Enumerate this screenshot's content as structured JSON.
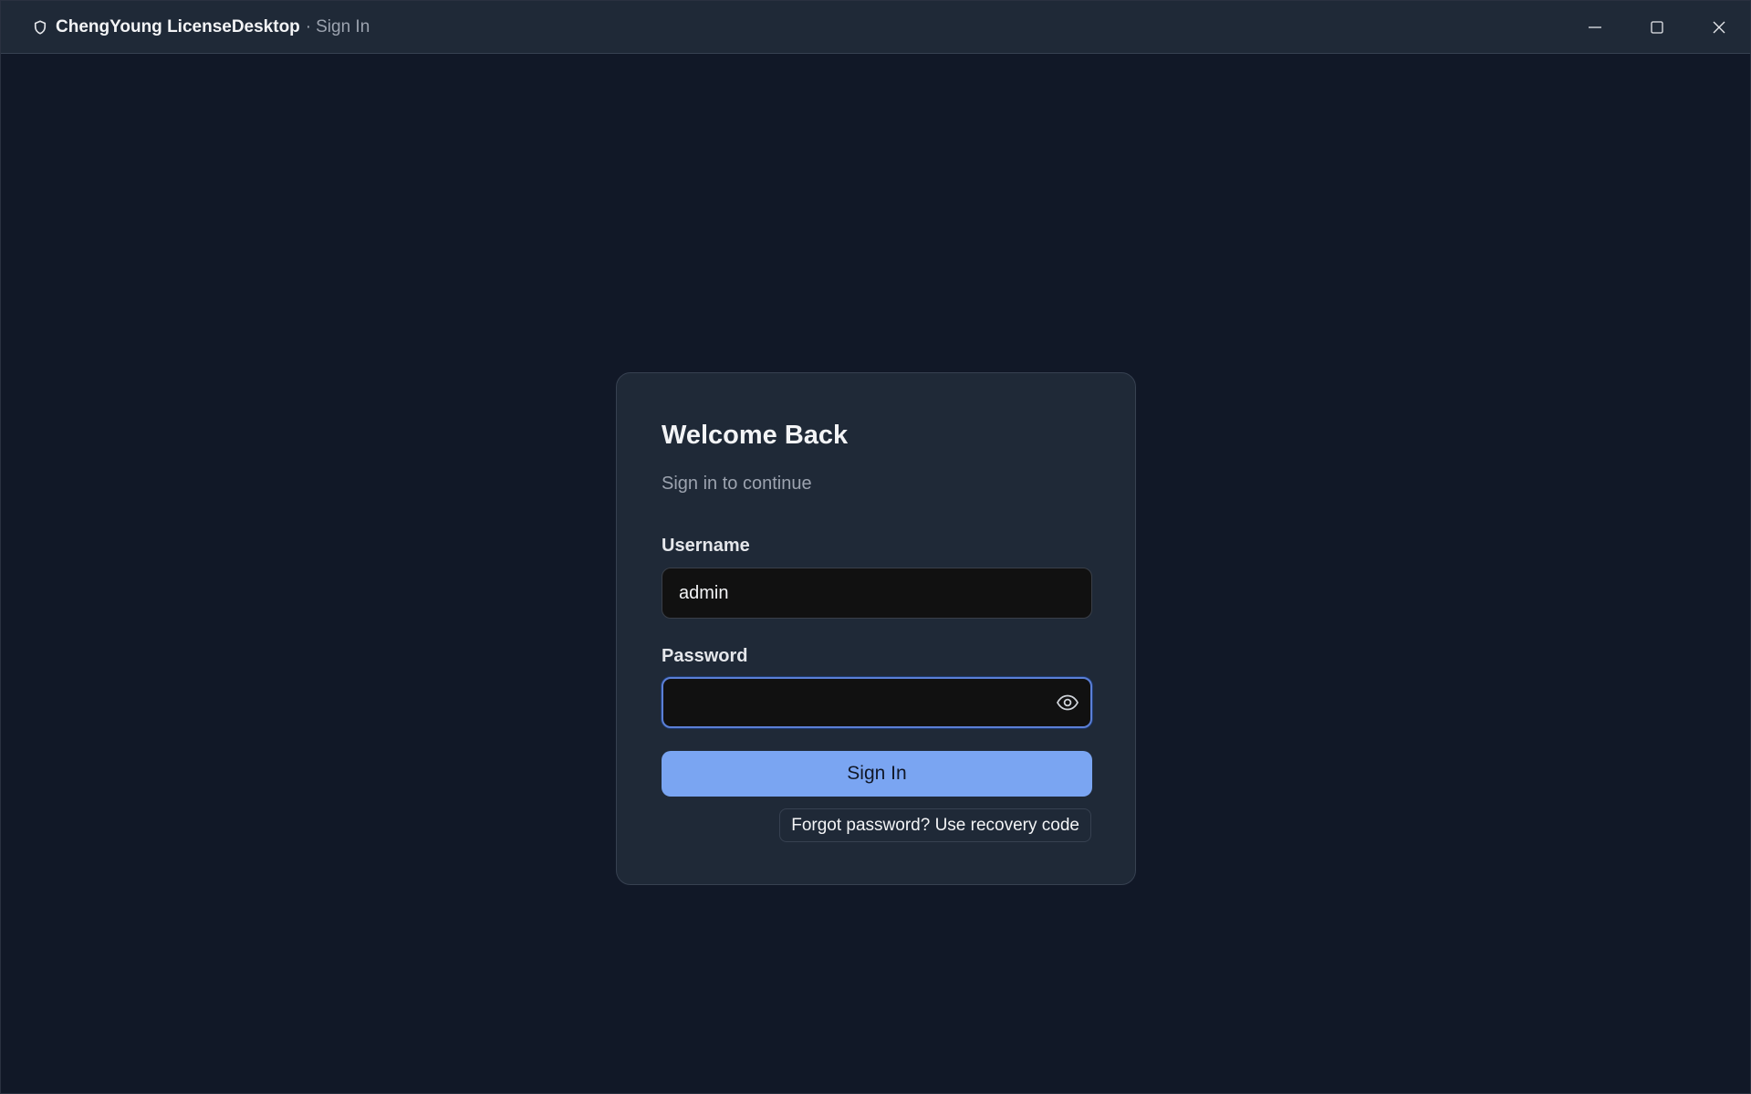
{
  "window": {
    "app_name": "ChengYoung LicenseDesktop",
    "separator": "·",
    "page_name": "Sign In"
  },
  "card": {
    "title": "Welcome Back",
    "subtitle": "Sign in to continue",
    "username": {
      "label": "Username",
      "value": "admin"
    },
    "password": {
      "label": "Password",
      "value": ""
    },
    "signin_label": "Sign In",
    "forgot_label": "Forgot password? Use recovery code"
  },
  "colors": {
    "background": "#111827",
    "card": "#1f2937",
    "accent": "#7aa5f2",
    "focus_border": "#5b7fd6"
  },
  "icons": {
    "title": "shield-icon",
    "minimize": "minimize-icon",
    "maximize": "maximize-icon",
    "close": "close-icon",
    "password_toggle": "eye-icon"
  }
}
